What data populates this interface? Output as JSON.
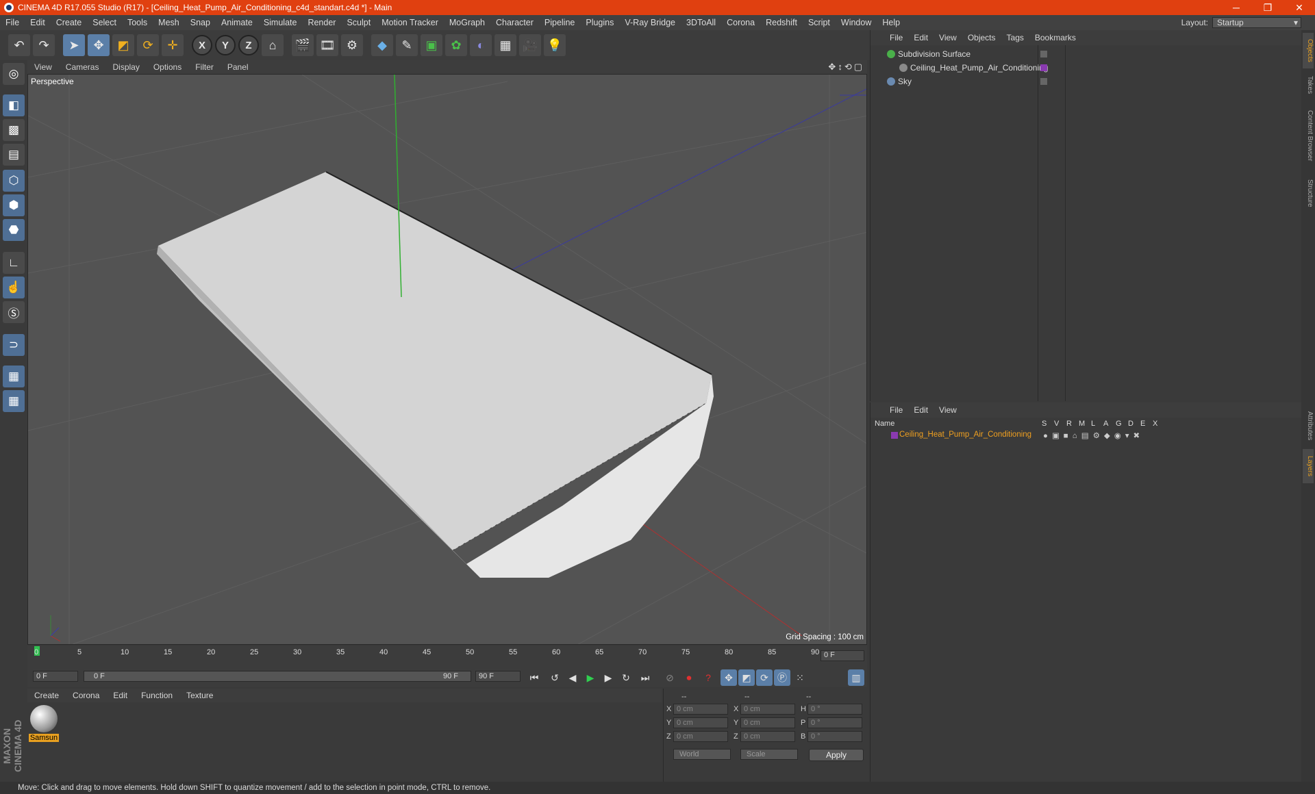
{
  "window": {
    "title": "CINEMA 4D R17.055 Studio (R17) - [Ceiling_Heat_Pump_Air_Conditioning_c4d_standart.c4d *] - Main",
    "min": "─",
    "restore": "❐",
    "close": "✕"
  },
  "menu": [
    "File",
    "Edit",
    "Create",
    "Select",
    "Tools",
    "Mesh",
    "Snap",
    "Animate",
    "Simulate",
    "Render",
    "Sculpt",
    "Motion Tracker",
    "MoGraph",
    "Character",
    "Pipeline",
    "Plugins",
    "V-Ray Bridge",
    "3DToAll",
    "Corona",
    "Redshift",
    "Script",
    "Window",
    "Help"
  ],
  "layout": {
    "label": "Layout:",
    "value": "Startup"
  },
  "toolbar": {
    "x": "X",
    "y": "Y",
    "z": "Z"
  },
  "viewport": {
    "menu": [
      "View",
      "Cameras",
      "Display",
      "Options",
      "Filter",
      "Panel"
    ],
    "label": "Perspective",
    "grid_spacing": "Grid Spacing : 100 cm",
    "nav_icons": "✥↕⟲▢"
  },
  "timeline": {
    "ticks": [
      "0",
      "5",
      "10",
      "15",
      "20",
      "25",
      "30",
      "35",
      "40",
      "45",
      "50",
      "55",
      "60",
      "65",
      "70",
      "75",
      "80",
      "85",
      "90"
    ],
    "current": "0 F"
  },
  "playbar": {
    "start": "0 F",
    "range_start": "0 F",
    "range_end": "90 F",
    "end": "90 F"
  },
  "materials": {
    "menu": [
      "Create",
      "Corona",
      "Edit",
      "Function",
      "Texture"
    ],
    "items": [
      {
        "name": "Samsun"
      }
    ]
  },
  "coords": {
    "headers": [
      "--",
      "--",
      "--"
    ],
    "rows": [
      {
        "a": "X",
        "av": "0 cm",
        "b": "X",
        "bv": "0 cm",
        "c": "H",
        "cv": "0 °"
      },
      {
        "a": "Y",
        "av": "0 cm",
        "b": "Y",
        "bv": "0 cm",
        "c": "P",
        "cv": "0 °"
      },
      {
        "a": "Z",
        "av": "0 cm",
        "b": "Z",
        "bv": "0 cm",
        "c": "B",
        "cv": "0 °"
      }
    ],
    "world": "World",
    "scale": "Scale",
    "apply": "Apply"
  },
  "objects": {
    "menu": [
      "File",
      "Edit",
      "View",
      "Objects",
      "Tags",
      "Bookmarks"
    ],
    "items": [
      {
        "name": "Subdivision Surface",
        "color": "#4ab04a"
      },
      {
        "name": "Ceiling_Heat_Pump_Air_Conditioning",
        "color": "#8a8a8a"
      },
      {
        "name": "Sky",
        "color": "#6a8ab0"
      }
    ]
  },
  "layers": {
    "menu": [
      "File",
      "Edit",
      "View"
    ],
    "headers": [
      "Name",
      "S",
      "V",
      "R",
      "M",
      "L",
      "A",
      "G",
      "D",
      "E",
      "X"
    ],
    "row": "Ceiling_Heat_Pump_Air_Conditioning",
    "layer_color": "#8a3ab0"
  },
  "sidetabs": [
    "Objects",
    "Takes",
    "Content Browser",
    "Structure",
    "Attributes",
    "Layers"
  ],
  "status": "Move: Click and drag to move elements. Hold down SHIFT to quantize movement / add to the selection in point mode, CTRL to remove.",
  "brand": "MAXON CINEMA 4D"
}
